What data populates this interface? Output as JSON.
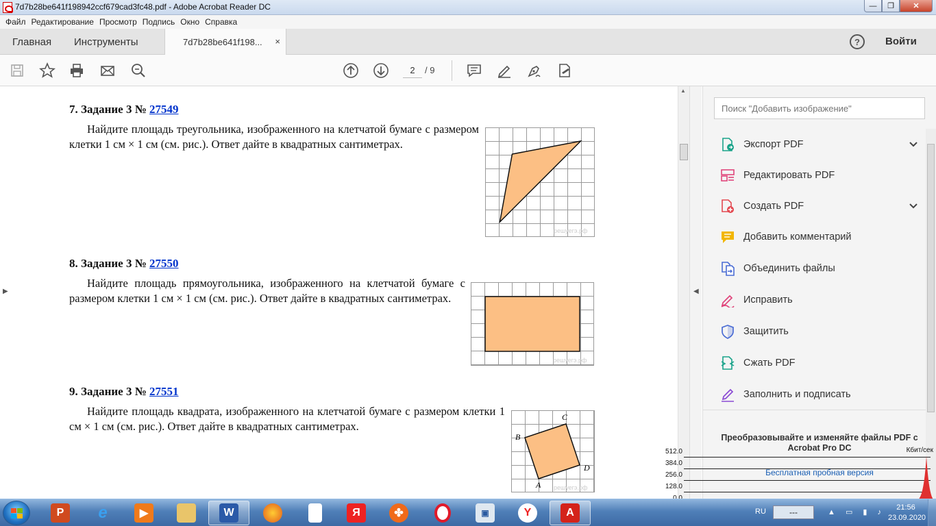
{
  "window": {
    "title": "7d7b28be641f198942ccf679cad3fc48.pdf - Adobe Acrobat Reader DC",
    "minimize": "—",
    "maximize": "❐",
    "close": "✕"
  },
  "menu": [
    "Файл",
    "Редактирование",
    "Просмотр",
    "Подпись",
    "Окно",
    "Справка"
  ],
  "tabs": {
    "home": "Главная",
    "tools": "Инструменты",
    "doc": "7d7b28be641f198...",
    "doc_close": "×",
    "help": "?",
    "signin": "Войти"
  },
  "toolbar": {
    "page_current": "2",
    "page_total": "/ 9"
  },
  "document": {
    "tasks": [
      {
        "title_prefix": "7. Задание 3 № ",
        "link": "27549",
        "text": "Найдите площадь треугольника, изображенного на клетчатой бумаге с размером клетки 1 см × 1 см (см. рис.). Ответ дайте в квадратных сантиметрах.",
        "figure_mark": "решуегэ.рф"
      },
      {
        "title_prefix": "8. Задание 3 № ",
        "link": "27550",
        "text": "Найдите площадь прямоугольника, изображенного на клетчатой бумаге с размером клетки 1 см × 1 см (см. рис.). Ответ дайте в квадратных сантиметрах.",
        "figure_mark": "решуегэ.рф"
      },
      {
        "title_prefix": "9. Задание 3 № ",
        "link": "27551",
        "text": "Найдите площадь квадрата, изображенного на клетчатой бумаге с размером клетки 1 см × 1 см (см. рис.). Ответ дайте в квадратных сантиметрах.",
        "figure_mark": "решуегэ.рф",
        "vertex_labels": [
          "A",
          "B",
          "C",
          "D"
        ]
      }
    ]
  },
  "right_panel": {
    "search_placeholder": "Поиск \"Добавить изображение\"",
    "items": [
      {
        "label": "Экспорт PDF",
        "icon": "export-pdf-icon",
        "color": "#1aa38a",
        "expandable": true
      },
      {
        "label": "Редактировать PDF",
        "icon": "edit-pdf-icon",
        "color": "#e0457b",
        "expandable": false
      },
      {
        "label": "Создать PDF",
        "icon": "create-pdf-icon",
        "color": "#e34850",
        "expandable": true
      },
      {
        "label": "Добавить комментарий",
        "icon": "comment-icon",
        "color": "#f2b600",
        "expandable": false
      },
      {
        "label": "Объединить файлы",
        "icon": "combine-files-icon",
        "color": "#4a6cd4",
        "expandable": false
      },
      {
        "label": "Исправить",
        "icon": "fix-pen-icon",
        "color": "#e0457b",
        "expandable": false
      },
      {
        "label": "Защитить",
        "icon": "protect-shield-icon",
        "color": "#4a6cd4",
        "expandable": false
      },
      {
        "label": "Сжать PDF",
        "icon": "compress-pdf-icon",
        "color": "#1aa38a",
        "expandable": false
      },
      {
        "label": "Заполнить и подписать",
        "icon": "fill-sign-icon",
        "color": "#8a4ad4",
        "expandable": false
      }
    ],
    "promo": "Преобразовывайте и изменяйте файлы PDF с Acrobat Pro DC",
    "trial": "Бесплатная пробная версия"
  },
  "net_monitor": {
    "labels": [
      "512.0",
      "384.0",
      "256.0",
      "128.0",
      "0.0"
    ],
    "unit": "Кбит/сек"
  },
  "taskbar": {
    "lang": "RU",
    "box": "---",
    "time": "21:56",
    "date": "23.09.2020"
  }
}
